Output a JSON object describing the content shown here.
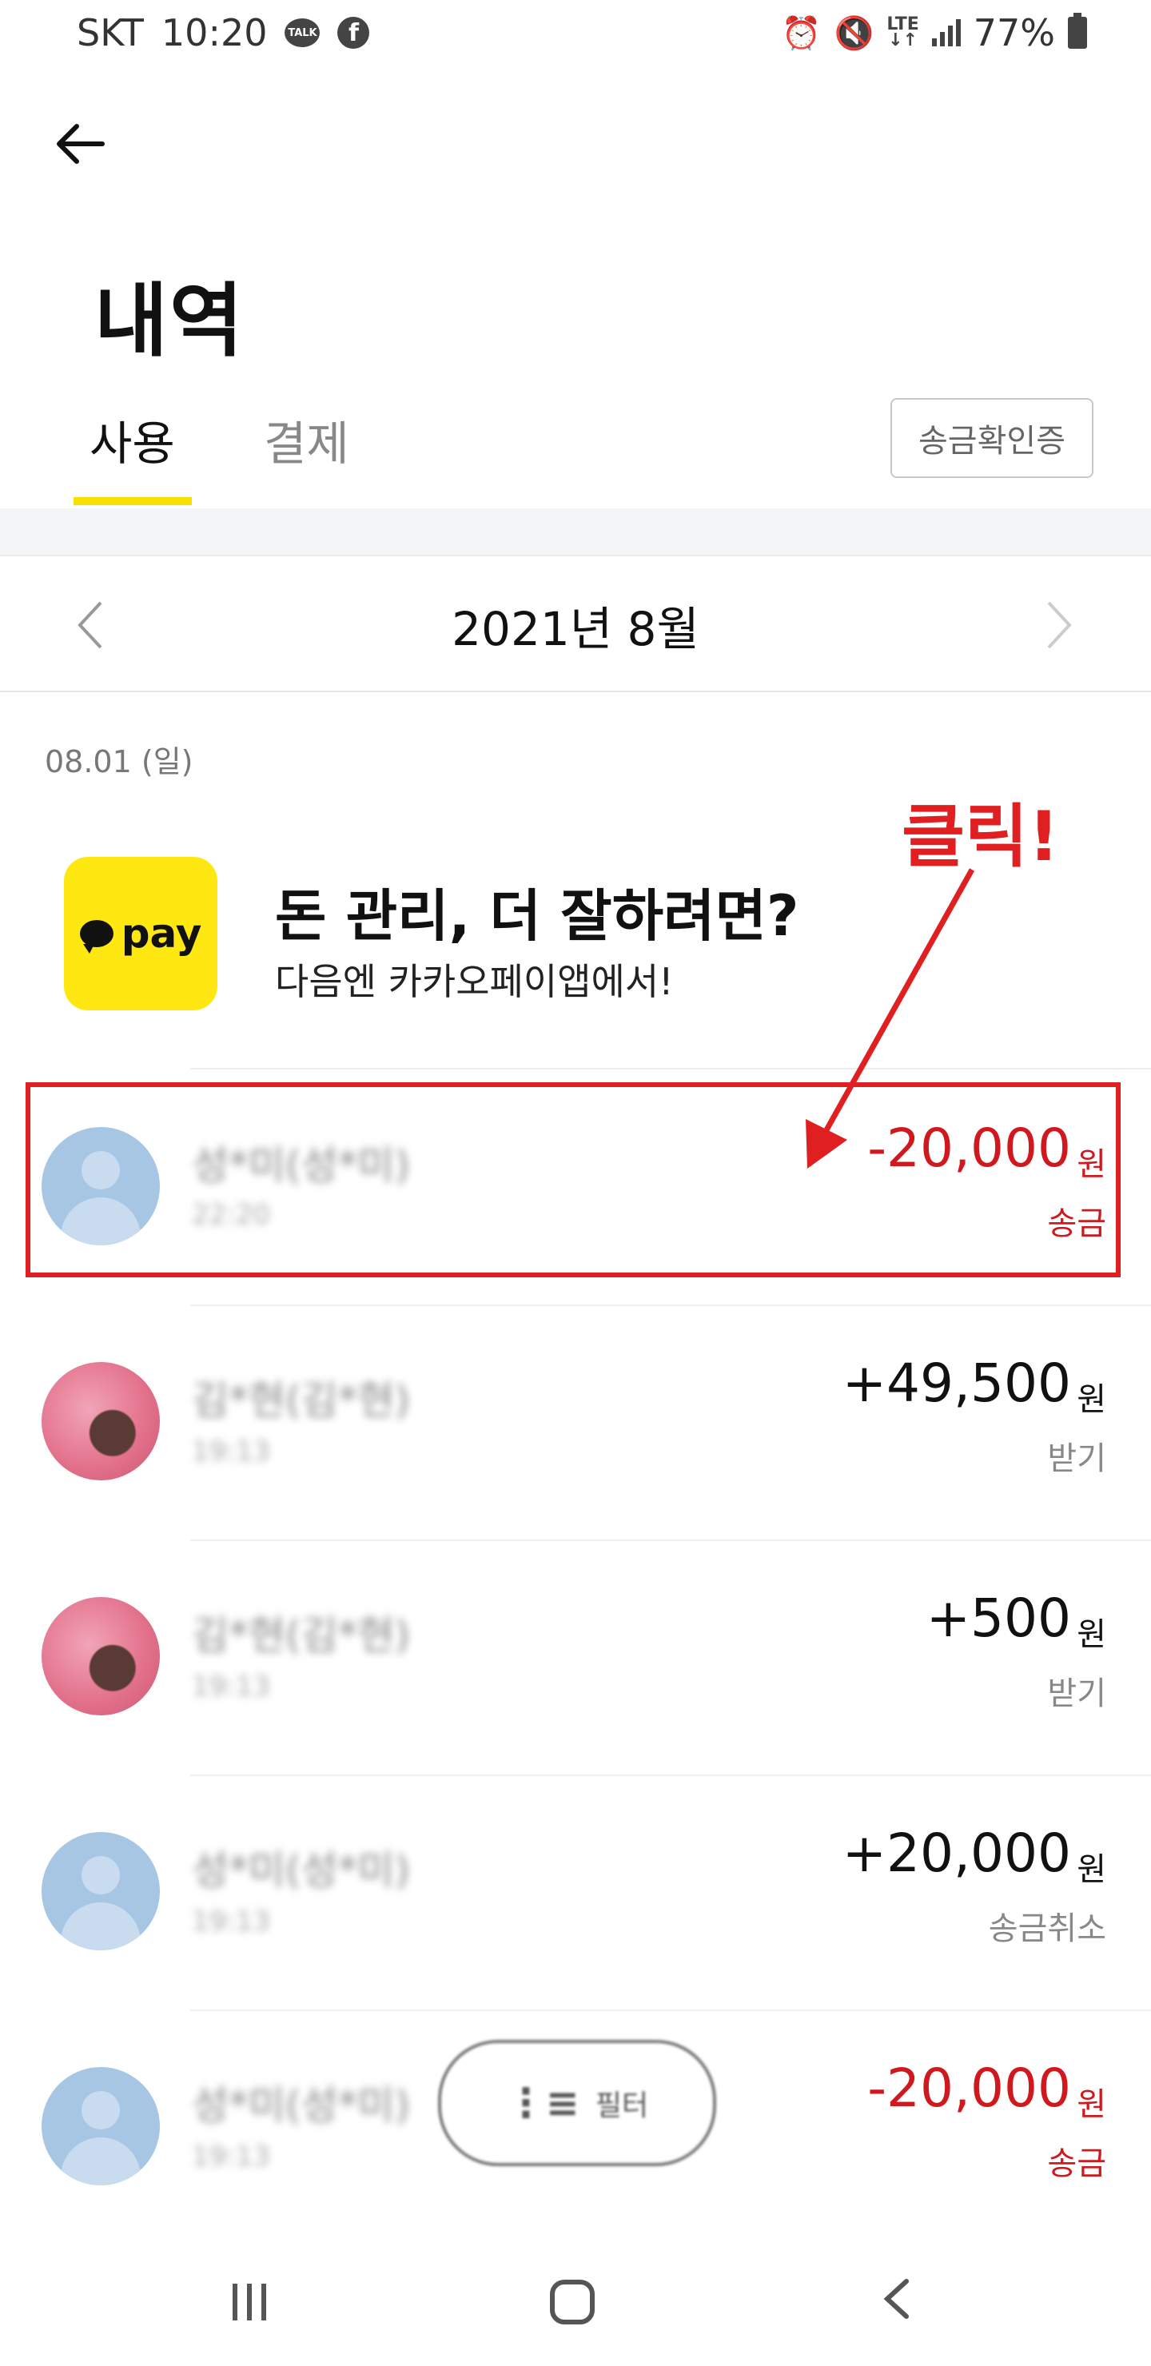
{
  "status_bar": {
    "carrier": "SKT",
    "time": "10:20",
    "talk_icon_text": "TALK",
    "facebook_icon_text": "f",
    "network": "LTE",
    "battery": "77%"
  },
  "header": {
    "title": "내역",
    "tabs": [
      {
        "label": "사용",
        "active": true
      },
      {
        "label": "결제",
        "active": false
      }
    ],
    "confirm_button_label": "송금확인증"
  },
  "month_selector": {
    "label": "2021년 8월"
  },
  "date_group": "08.01 (일)",
  "annotation": {
    "text": "클릭!",
    "color": "#e02020"
  },
  "banner": {
    "logo_text": "pay",
    "title": "돈 관리, 더 잘하려면?",
    "subtitle": "다음엔 카카오페이앱에서!"
  },
  "transactions": [
    {
      "name": "성*미(성*미)",
      "time": "22:20",
      "amount": "-20,000",
      "unit": "원",
      "type": "송금",
      "avatar": "default",
      "negative": true,
      "highlighted": true
    },
    {
      "name": "김*현(김*현)",
      "time": "19:13",
      "amount": "+49,500",
      "unit": "원",
      "type": "받기",
      "avatar": "photo",
      "negative": false
    },
    {
      "name": "김*현(김*현)",
      "time": "19:13",
      "amount": "+500",
      "unit": "원",
      "type": "받기",
      "avatar": "photo",
      "negative": false
    },
    {
      "name": "성*미(성*미)",
      "time": "19:13",
      "amount": "+20,000",
      "unit": "원",
      "type": "송금취소",
      "avatar": "default",
      "negative": false
    },
    {
      "name": "성*미(성*미)",
      "time": "19:13",
      "amount": "-20,000",
      "unit": "원",
      "type": "송금",
      "avatar": "default",
      "negative": true
    }
  ],
  "filter_button": {
    "label": "필터"
  },
  "colors": {
    "accent_yellow": "#f9e000",
    "negative_red": "#d0191e",
    "annotation_red": "#e02020"
  }
}
